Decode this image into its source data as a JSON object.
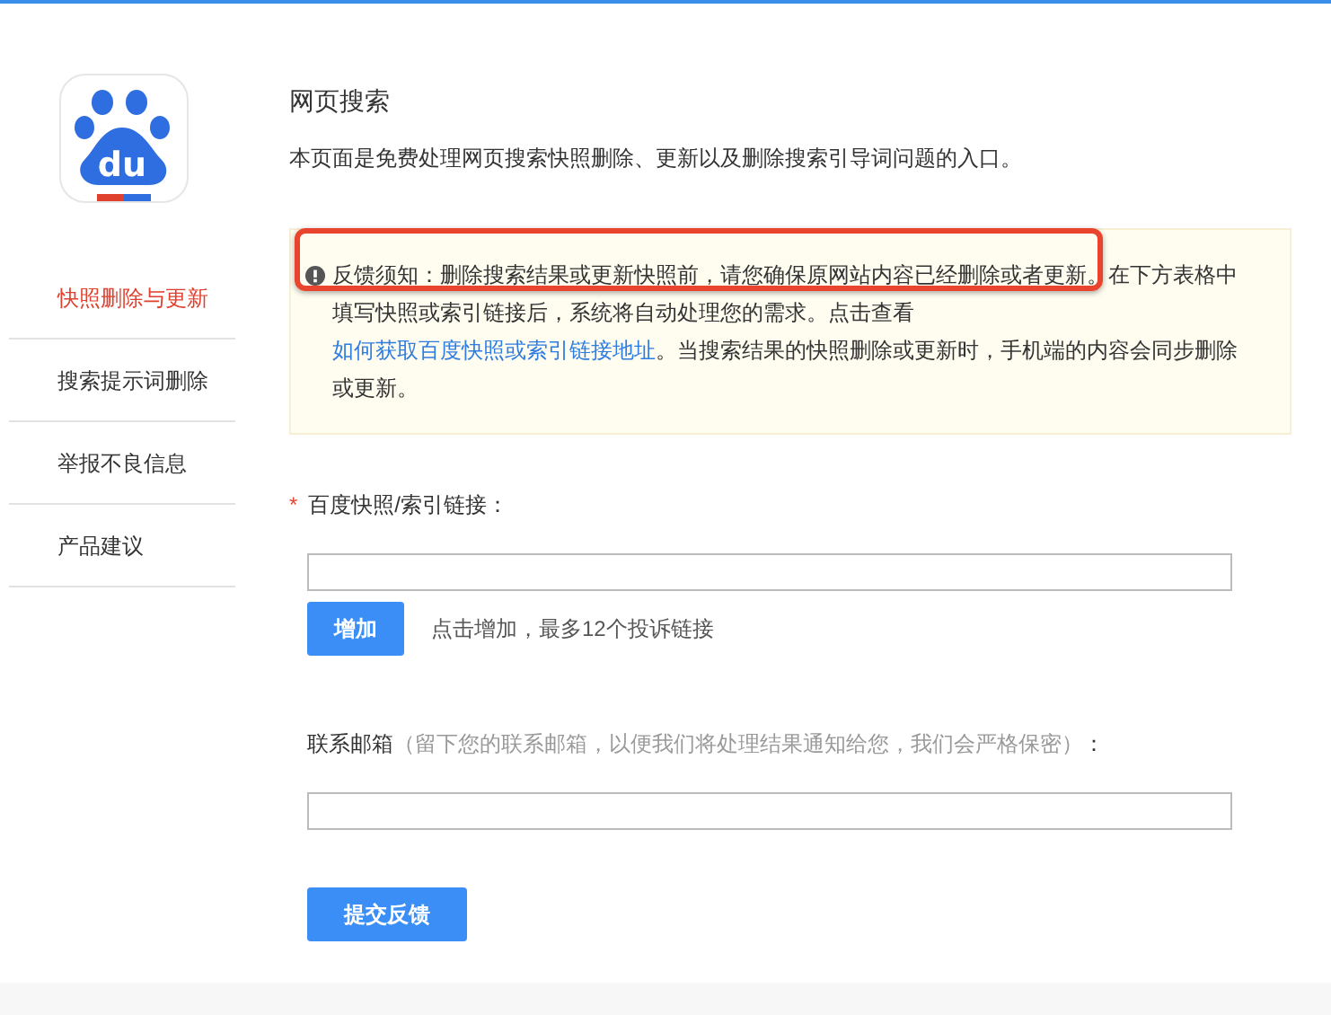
{
  "logo": {
    "text": "du"
  },
  "sidebar": {
    "items": [
      {
        "label": "快照删除与更新",
        "selected": true
      },
      {
        "label": "搜索提示词删除",
        "selected": false
      },
      {
        "label": "举报不良信息",
        "selected": false
      },
      {
        "label": "产品建议",
        "selected": false
      }
    ]
  },
  "header": {
    "title": "网页搜索",
    "subtitle": "本页面是免费处理网页搜索快照删除、更新以及删除搜索引导词问题的入口。"
  },
  "notice": {
    "text": "反馈须知：删除搜索结果或更新快照前，请您确保原网站内容已经删除或者更新。在下方表格中填写快照或索引链接后，系统将自动处理您的需求。点击查看",
    "link": "如何获取百度快照或索引链接地址",
    "text_after": "。当搜索结果的快照删除或更新时，手机端的内容会同步删除或更新。",
    "highlighted": true
  },
  "form": {
    "link_field": {
      "required_mark": "*",
      "label": "百度快照/索引链接："
    },
    "add_button": "增加",
    "add_hint": "点击增加，最多12个投诉链接",
    "email_field": {
      "label": "联系邮箱",
      "hint": "（留下您的联系邮箱，以便我们将处理结果通知给您，我们会严格保密）",
      "colon": "："
    },
    "submit_button": "提交反馈"
  }
}
